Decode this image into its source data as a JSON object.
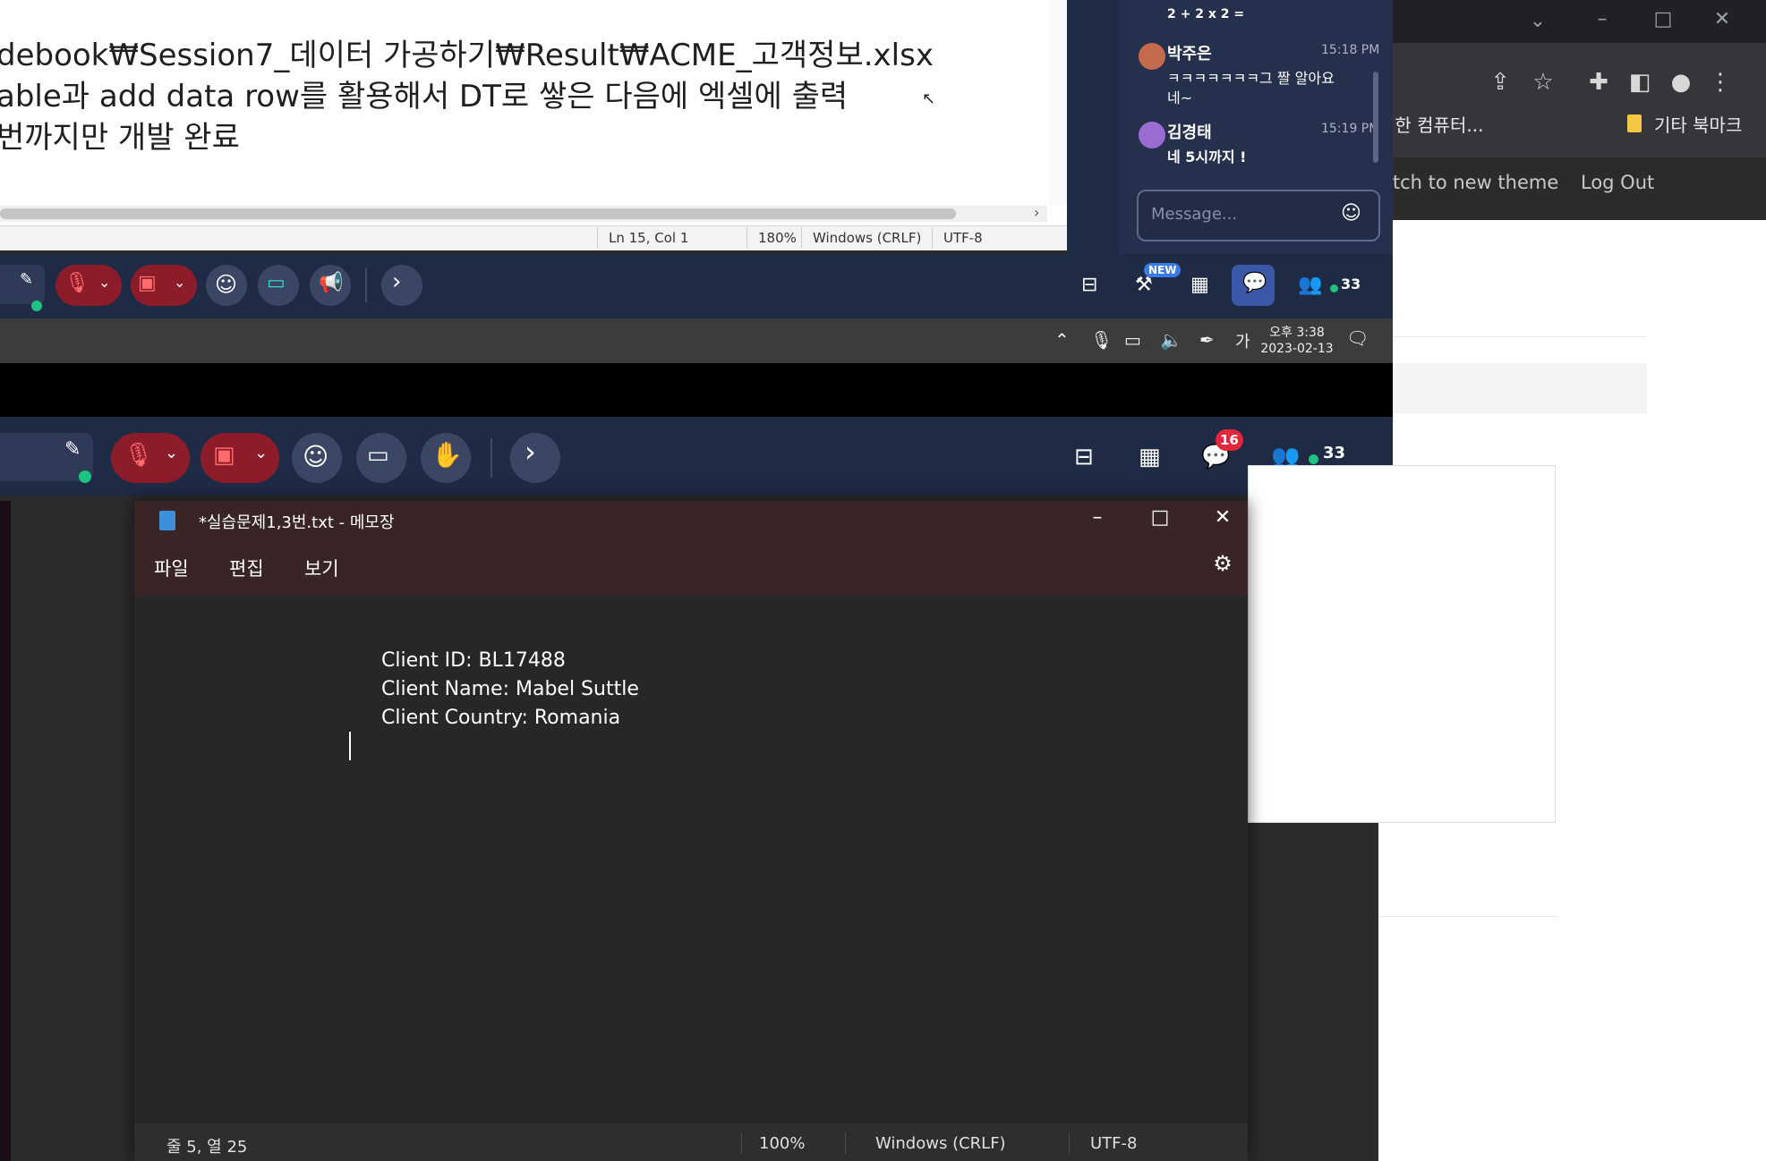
{
  "browser": {
    "tab_title_partial": "위한 컴퓨터...",
    "bookmark_other": "기타 북마크",
    "nav_switch_theme": "itch to new theme",
    "nav_logout": "Log Out"
  },
  "notepad_top": {
    "lines": [
      "debook₩Session7_데이터 가공하기₩Result₩ACME_고객정보.xlsx",
      "able과 add data row를 활용해서 DT로 쌓은 다음에 엑셀에 출력",
      "번까지만 개발 완료"
    ],
    "status": {
      "position": "Ln 15, Col 1",
      "zoom": "180%",
      "line_ending": "Windows (CRLF)",
      "encoding": "UTF-8"
    }
  },
  "chat": {
    "partial_top_message": "2 + 2 x 2 =",
    "messages": [
      {
        "name": "박주은",
        "time": "15:18 PM",
        "lines": [
          "ㅋㅋㅋㅋㅋㅋㅋ그 짤 알아요",
          "네~"
        ]
      },
      {
        "name": "김경태",
        "time": "15:19 PM",
        "lines": [
          "네 5시까지 !"
        ]
      }
    ],
    "input_placeholder": "Message..."
  },
  "meeting_bar_top": {
    "new_badge": "NEW",
    "participant_count": "33"
  },
  "taskbar": {
    "ime_indicator": "가",
    "time": "오후 3:38",
    "date": "2023-02-13"
  },
  "meeting_bar_bottom": {
    "chat_badge": "16",
    "participant_count": "33"
  },
  "notepad_main": {
    "title": "*실습문제1,3번.txt - 메모장",
    "menu": [
      "파일",
      "편집",
      "보기"
    ],
    "lines": [
      "Client ID: BL17488",
      "Client Name: Mabel Suttle",
      "Client Country: Romania"
    ],
    "status": {
      "position": "줄 5, 열 25",
      "zoom": "100%",
      "line_ending": "Windows (CRLF)",
      "encoding": "UTF-8"
    }
  },
  "colors": {
    "meeting_bg": "#1f2a44",
    "mute_red": "#8c1c2a",
    "notepad_title_bg": "#3a2526",
    "green_status": "#1ec281",
    "badge_red": "#e0273b",
    "new_badge_blue": "#3b7be8"
  }
}
